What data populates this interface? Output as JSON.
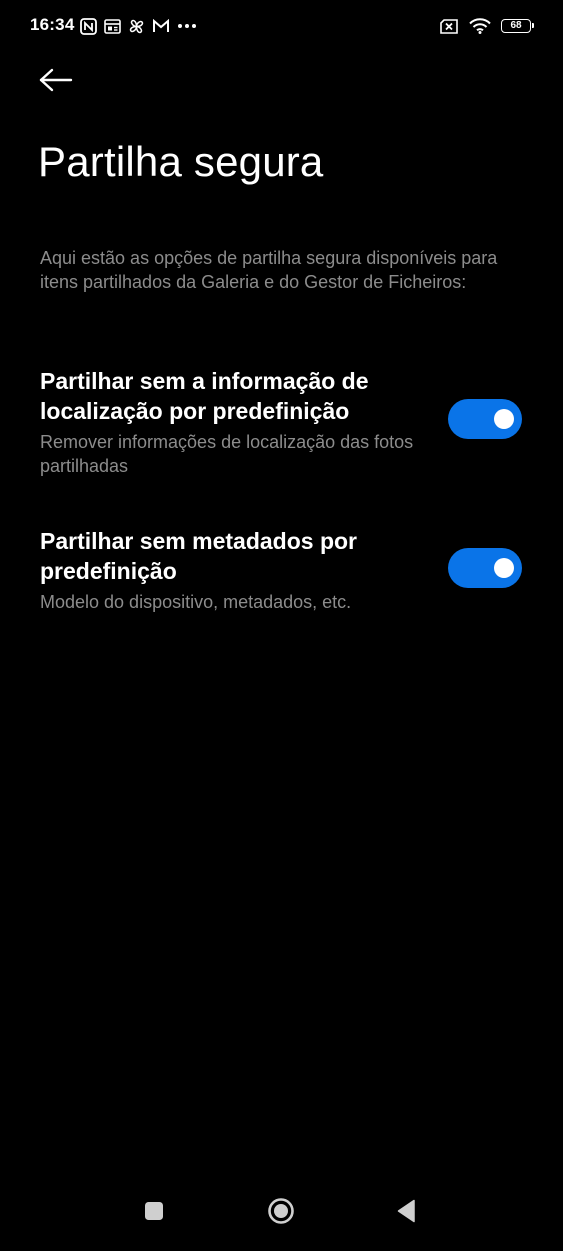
{
  "status_bar": {
    "time": "16:34",
    "left_icons": [
      "nfc-icon",
      "news-icon",
      "pinwheel-icon",
      "gmail-icon",
      "more-dots-icon"
    ],
    "right_icons": [
      "sim-disabled-icon",
      "wifi-icon",
      "battery-icon"
    ],
    "battery_level": "68"
  },
  "header": {
    "back_icon": "arrow-left-icon",
    "title": "Partilha segura"
  },
  "description": "Aqui estão as opções de partilha segura disponíveis para itens partilhados da Galeria e do Gestor de Ficheiros:",
  "settings": [
    {
      "title": "Partilhar sem a informação de localização por predefinição",
      "subtitle": "Remover informações de localização das fotos partilhadas",
      "enabled": true
    },
    {
      "title": "Partilhar sem metadados por predefinição",
      "subtitle": "Modelo do dispositivo, metadados, etc.",
      "enabled": true
    }
  ],
  "nav_bar": {
    "buttons": [
      "recents-square-icon",
      "home-circle-icon",
      "back-triangle-icon"
    ]
  },
  "colors": {
    "background": "#000000",
    "accent": "#0a74e8",
    "secondary_text": "#8c8c8c"
  }
}
